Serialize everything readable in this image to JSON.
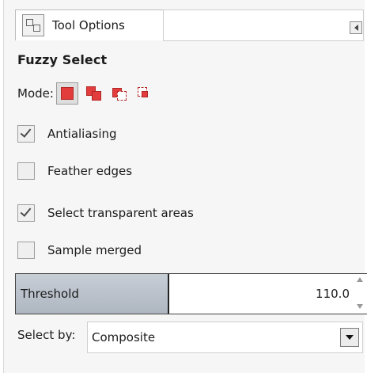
{
  "header": {
    "tab_label": "Tool Options",
    "tab_icon": "tool-options-icon",
    "close_icon": "collapse-panel-icon"
  },
  "tool": {
    "title": "Fuzzy Select"
  },
  "mode": {
    "label": "Mode:",
    "options": [
      {
        "name": "replace",
        "icon": "replace-selection-icon",
        "active": true
      },
      {
        "name": "add",
        "icon": "add-selection-icon",
        "active": false
      },
      {
        "name": "subtract",
        "icon": "subtract-selection-icon",
        "active": false
      },
      {
        "name": "intersect",
        "icon": "intersect-selection-icon",
        "active": false
      }
    ]
  },
  "options": [
    {
      "label": "Antialiasing",
      "checked": true
    },
    {
      "label": "Feather edges",
      "checked": false
    },
    {
      "label": "Select transparent areas",
      "checked": true
    },
    {
      "label": "Sample merged",
      "checked": false
    }
  ],
  "threshold": {
    "label": "Threshold",
    "value": "110.0",
    "max": 255
  },
  "select_by": {
    "label": "Select by:",
    "value": "Composite"
  },
  "colors": {
    "accent_red": "#e23c3c",
    "slider_fill": "#b8c0ca"
  }
}
